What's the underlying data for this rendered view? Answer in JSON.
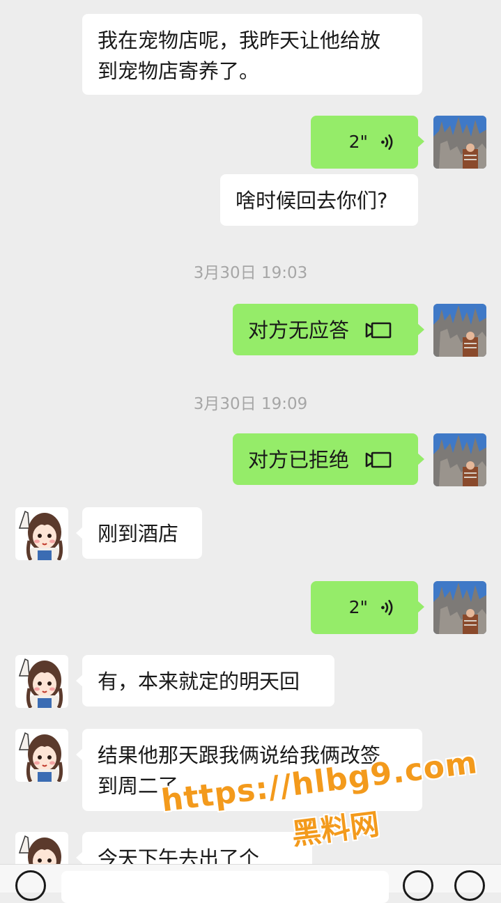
{
  "messages": {
    "m1": "我在宠物店呢，我昨天让他给放",
    "m1b": "到宠物店寄养了。",
    "v1": "2\"",
    "m2": "啥时候回去你们?",
    "ts1": "3月30日 19:03",
    "call1": "对方无应答",
    "ts2": "3月30日 19:09",
    "call2": "对方已拒绝",
    "m3": "刚到酒店",
    "v2": "2\"",
    "m4": "有，本来就定的明天回",
    "m5a": "结果他那天跟我俩说给我俩改签",
    "m5b": "到周二了",
    "m6": "今天下午去出了个"
  },
  "watermark": {
    "url": "https://hlbg9.com",
    "name": "黑料网"
  },
  "colors": {
    "outgoing_bubble": "#95ec69",
    "incoming_bubble": "#ffffff",
    "background": "#ededed",
    "timestamp": "#a6a6a6",
    "watermark": "#f39a1c"
  },
  "icons": {
    "voice": "voice-wave-icon",
    "video_call": "video-call-icon",
    "voice_input": "voice-input-icon",
    "emoji": "emoji-icon",
    "add": "plus-icon"
  }
}
